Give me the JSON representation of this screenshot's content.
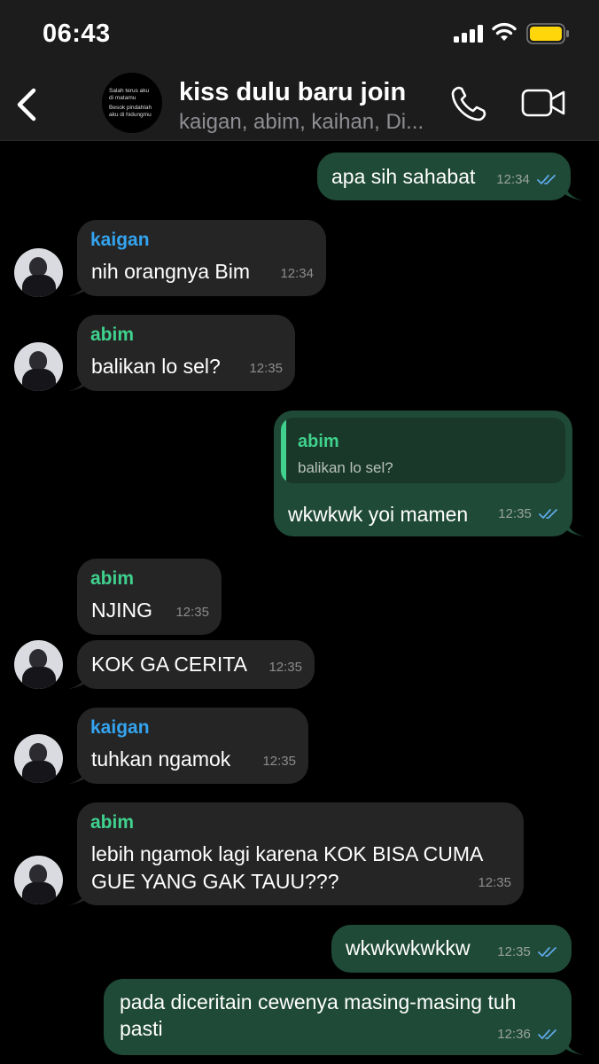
{
  "status": {
    "time": "06:43"
  },
  "header": {
    "title": "kiss dulu baru join",
    "members": "kaigan, abim, kaihan, Di...",
    "avatar_lines": [
      "Salah terus aku",
      "di matamu",
      "Besok pindahlah",
      "aku di hidungmu"
    ]
  },
  "messages": [
    {
      "dir": "out",
      "text": "apa sih sahabat",
      "time": "12:34",
      "status": "read"
    },
    {
      "dir": "in",
      "sender": "kaigan",
      "text": "nih orangnya Bim",
      "time": "12:34"
    },
    {
      "dir": "in",
      "sender": "abim",
      "text": "balikan lo sel?",
      "time": "12:35"
    },
    {
      "dir": "out",
      "reply_to": {
        "sender": "abim",
        "text": "balikan lo sel?"
      },
      "text": "wkwkwk yoi mamen",
      "time": "12:35",
      "status": "read"
    },
    {
      "dir": "in",
      "sender": "abim",
      "text": "NJING",
      "time": "12:35"
    },
    {
      "dir": "in",
      "text": "KOK GA CERITA",
      "time": "12:35"
    },
    {
      "dir": "in",
      "sender": "kaigan",
      "text": "tuhkan ngamok",
      "time": "12:35"
    },
    {
      "dir": "in",
      "sender": "abim",
      "text_lines": [
        "lebih ngamok lagi karena KOK BISA CUMA",
        "GUE YANG GAK TAUU???"
      ],
      "time": "12:35"
    },
    {
      "dir": "out",
      "text": "wkwkwkwkkw",
      "time": "12:35",
      "status": "read"
    },
    {
      "dir": "out",
      "text_lines": [
        "pada diceritain cewenya masing-masing tuh",
        "pasti"
      ],
      "time": "12:36",
      "status": "read"
    }
  ],
  "colors": {
    "incoming": "#252525",
    "outgoing": "#1f4a37",
    "name_kaigan": "#34a4f0",
    "name_abim": "#3fd18d",
    "read_ticks": "#5fa8e8"
  },
  "icons": [
    "back-chevron-icon",
    "phone-icon",
    "video-camera-icon",
    "signal-icon",
    "wifi-icon",
    "battery-icon",
    "double-check-icon"
  ]
}
